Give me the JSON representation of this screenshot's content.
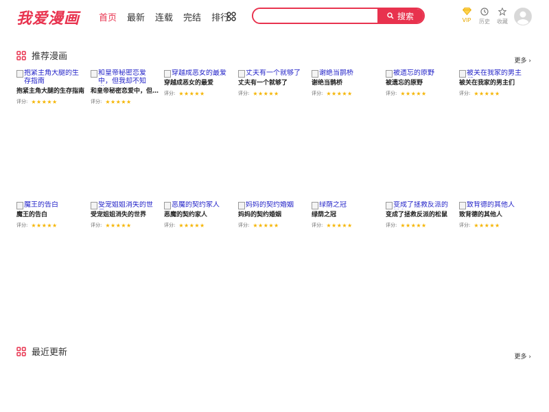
{
  "header": {
    "logo": "我爱漫画",
    "nav": [
      "首页",
      "最新",
      "连载",
      "完结",
      "排行"
    ],
    "search": {
      "placeholder": "",
      "button": "搜索"
    },
    "util": {
      "vip": "VIP",
      "history": "历史",
      "favorites": "收藏"
    }
  },
  "recommended": {
    "title": "推荐漫画",
    "more": "更多",
    "rating_label": "评分:",
    "items": [
      {
        "alt": "抱紧主角大腿的生存指南",
        "name": "抱紧主角大腿的生存指南"
      },
      {
        "alt": "和皇帝秘密恋爱中，但我却不知道！",
        "name": "和皇帝秘密恋爱中，但..."
      },
      {
        "alt": "穿越成恶女的最爱",
        "name": "穿越成恶女的最爱"
      },
      {
        "alt": "丈夫有一个就够了",
        "name": "丈夫有一个就够了"
      },
      {
        "alt": "谢绝当鹊桥",
        "name": "谢绝当鹊桥"
      },
      {
        "alt": "被遗忘的原野",
        "name": "被遗忘的原野"
      },
      {
        "alt": "被关在我家的男主们",
        "name": "被关在我家的男主们"
      },
      {
        "alt": "魔王的告白",
        "name": "魔王的告白"
      },
      {
        "alt": "受宠姐姐消失的世界",
        "name": "受宠姐姐消失的世界"
      },
      {
        "alt": "恶魔的契约家人",
        "name": "恶魔的契约家人"
      },
      {
        "alt": "妈妈的契约婚姻",
        "name": "妈妈的契约婚姻"
      },
      {
        "alt": "绿荫之冠",
        "name": "绿荫之冠"
      },
      {
        "alt": "变成了拯救反派的松鼠",
        "name": "变成了拯救反派的松鼠"
      },
      {
        "alt": "致背德的其他人",
        "name": "致背德的其他人"
      }
    ]
  },
  "latest": {
    "title": "最近更新",
    "more": "更多"
  }
}
